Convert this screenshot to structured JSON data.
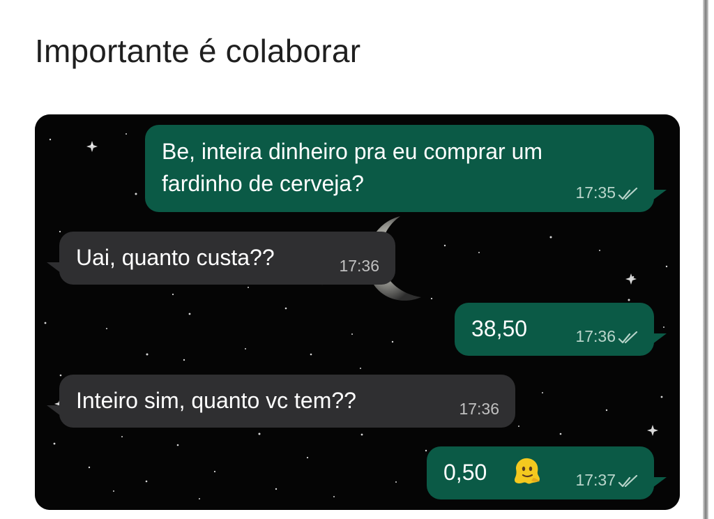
{
  "post": {
    "title": "Importante é colaborar"
  },
  "chat": {
    "messages": [
      {
        "direction": "outgoing",
        "text": "Be, inteira dinheiro pra eu comprar um fardinho de cerveja?",
        "line_1": "Be, inteira dinheiro pra eu comprar um",
        "line_2": "fardinho de cerveja?",
        "time": "17:35",
        "status_icon": "double-check-icon"
      },
      {
        "direction": "incoming",
        "text": "Uai, quanto custa??",
        "time": "17:36"
      },
      {
        "direction": "outgoing",
        "text": "38,50",
        "time": "17:36",
        "status_icon": "double-check-icon"
      },
      {
        "direction": "incoming",
        "text": "Inteiro sim, quanto vc tem??",
        "time": "17:36"
      },
      {
        "direction": "outgoing",
        "text": "0,50",
        "time": "17:37",
        "status_icon": "double-check-icon",
        "emoji": "melting-face-emoji"
      }
    ]
  },
  "colors": {
    "outgoing_bubble": "#0b5a46",
    "incoming_bubble": "#2f2f31",
    "chat_background": "#050505",
    "text": "#ffffff"
  }
}
